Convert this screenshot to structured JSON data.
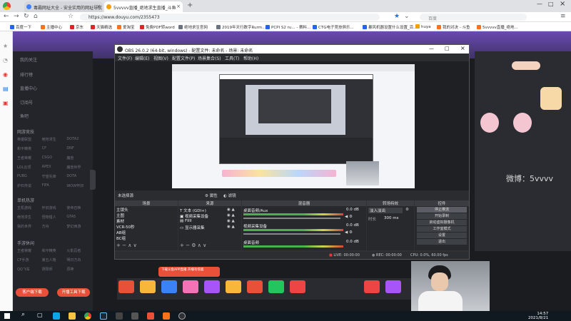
{
  "browser": {
    "tabs": [
      {
        "label": "毒霸网址大全 - 安全实用的网址导航",
        "active": false,
        "color": "#3b82f6"
      },
      {
        "label": "5vvvvv直播_绝地求生直播_斗鱼",
        "active": true,
        "color": "#f59e0b"
      }
    ],
    "url": "https://www.douyu.com/2355473",
    "search_placeholder": "百度",
    "bookmarks": [
      {
        "label": "百度一下",
        "color": "#2563eb"
      },
      {
        "label": "主播中心",
        "color": "#f97316"
      },
      {
        "label": "京东",
        "color": "#dc2626"
      },
      {
        "label": "天猫精选",
        "color": "#dc2626"
      },
      {
        "label": "爱淘宝",
        "color": "#f97316"
      },
      {
        "label": "免费PDF转word",
        "color": "#dc2626"
      },
      {
        "label": "绝地求生官网",
        "color": "#6b7280"
      },
      {
        "label": "2019年天行数字Rurm...",
        "color": "#6b7280"
      },
      {
        "label": "PCPI S2 ru... - 赛料...",
        "color": "#2563eb"
      },
      {
        "label": "CTG电子竞技俱乐...",
        "color": "#2563eb"
      },
      {
        "label": "暴风机器设置什么设置_百...",
        "color": "#2563eb"
      },
      {
        "label": "huya",
        "color": "#f59e0b"
      },
      {
        "label": "我的对决 - 斗鱼",
        "color": "#f97316"
      },
      {
        "label": "5vvvvv直播_绝地...",
        "color": "#f97316"
      }
    ]
  },
  "sidebar": {
    "items": [
      "我的关注",
      "排行榜",
      "直播中心",
      "订阅号",
      "鱼吧"
    ],
    "section_hot": "网游竞技",
    "hot_items": [
      "英雄联盟",
      "绝地求生",
      "DOTA2",
      "和平精英",
      "CF",
      "DNF",
      "王者荣耀",
      "CSGO",
      "魔兽",
      "LOL云顶",
      "APEX",
      "魔兽世界",
      "PUBG",
      "守望先锋",
      "DOTA",
      "炉石传说",
      "FIFA",
      "WOW怀旧"
    ],
    "section_single": "单机热游",
    "single_items": [
      "主机游戏",
      "怀旧游戏",
      "使命召唤",
      "绝地求生",
      "怪物猎人",
      "GTA5",
      "我的世界",
      "方舟",
      "梦幻西游"
    ],
    "section_mobile": "手游休闲",
    "mobile_items": [
      "王者荣耀",
      "和平精英",
      "火影忍者",
      "CF手游",
      "第五人格",
      "明日方舟",
      "QQ飞车",
      "阴阳师",
      "原神"
    ],
    "btn_left": "客户端下载",
    "btn_right": "开播工具下载"
  },
  "obs": {
    "title": "OBS 26.0.2 (64-bit, windows) - 配置文件: 未命名 - 场景: 未命名",
    "menu": [
      "文件(F)",
      "编辑(E)",
      "视图(V)",
      "配置文件(P)",
      "场景集合(S)",
      "工具(T)",
      "帮助(H)"
    ],
    "source_label": "未选择源",
    "props_btn": "属性",
    "filters_btn": "滤镜",
    "docks": {
      "scenes": "场景",
      "sources": "来源",
      "mixer": "混音器",
      "transitions": "转场特效",
      "controls": "控件"
    },
    "scenes": [
      "主镜头",
      "主图",
      "素材",
      "VCR-50秒",
      "AB组",
      "BC组"
    ],
    "sources": [
      "文本 (GDI+)",
      "视频采集设备",
      "FIIII",
      "显示器采集"
    ],
    "mixer": [
      {
        "name": "桌面音频/Aux",
        "level": "0.0 dB"
      },
      {
        "name": "视频采集设备",
        "level": "0.0 dB"
      },
      {
        "name": "桌面音频",
        "level": "0.0 dB"
      }
    ],
    "transition": "淡入淡出",
    "duration_label": "时长",
    "duration": "300 ms",
    "controls": [
      "停止推流",
      "开始录制",
      "启动虚拟摄像机",
      "工作室模式",
      "设置",
      "退出"
    ],
    "status": {
      "live": "LIVE: 00:00:00",
      "rec": "REC: 00:00:00",
      "cpu": "CPU: 0.0%, 60.00 fps"
    }
  },
  "stream": {
    "weibo": "微博：5vvvv",
    "banner_text": "下载斗鱼APP直播 开播有惊喜"
  },
  "taskbar": {
    "time": "14:57",
    "date": "2021/8/21"
  }
}
